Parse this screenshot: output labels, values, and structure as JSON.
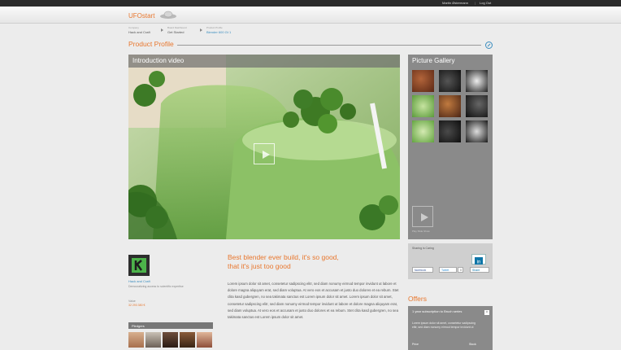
{
  "topbar": {
    "user_name": "Martin Østermann",
    "logout": "Log Out"
  },
  "header": {
    "logo": "UFOstart"
  },
  "breadcrumb": [
    {
      "small": "Company",
      "big": "Hack and Craft"
    },
    {
      "small": "Board Dashboard",
      "big": "Get Started"
    },
    {
      "small": "Product Profile",
      "big": "Blender 600 Gt 1"
    }
  ],
  "page": {
    "title": "Product Profile"
  },
  "video": {
    "label": "Introduction video"
  },
  "gallery": {
    "title": "Picture Gallery",
    "play_label": "Play Slide Show"
  },
  "company": {
    "name": "Hack and Craft",
    "description": "Democratizing access to scientific expertise",
    "value_label": "Value",
    "value": "32 293 380 €"
  },
  "pledgers": {
    "label": "Pledgers"
  },
  "product": {
    "headline_1": "Best blender ever build, it's so good,",
    "headline_2": "that it's just too good",
    "body": "Lorem ipsum dolor sit amet, consetetur sadipscing elitr, sed diam nonumy eirmod tempor invidunt ut labore et dolore magna aliquyam erat, sed diam voluptua. At vero eos et accusam et justo duo dolores et ea rebum. Stet clita kasd gubergren, no sea takimata sanctus est Lorem ipsum dolor sit amet. Lorem ipsum dolor sit amet, consetetur sadipscing elitr, sed diam nonumy eirmod tempor invidunt ut labore et dolore magna aliquyam erat, sed diam voluptua. At vero eos et accusam et justo duo dolores et ea rebum. Stet clita kasd gubergren, no sea takimata sanctus est Lorem ipsum dolor sit amet."
  },
  "share": {
    "label": "Sharing is Caring",
    "facebook": "facebook",
    "tweet": "Tweet",
    "tweet_count": "0",
    "linkedin": "Share"
  },
  "offers": {
    "title": "Offers",
    "card_head": "1 year subscription to Bruch series",
    "card_desc": "Lorem ipsum dolor sit amet, consetetur sadipscing elitr, sed diam nonumy eirmod tempor invidunt ut",
    "price_label": "Price",
    "stock_label": "Stock"
  },
  "colors": {
    "accent": "#e8772e",
    "link": "#3a8dbf",
    "panel": "#8a8a8a"
  }
}
